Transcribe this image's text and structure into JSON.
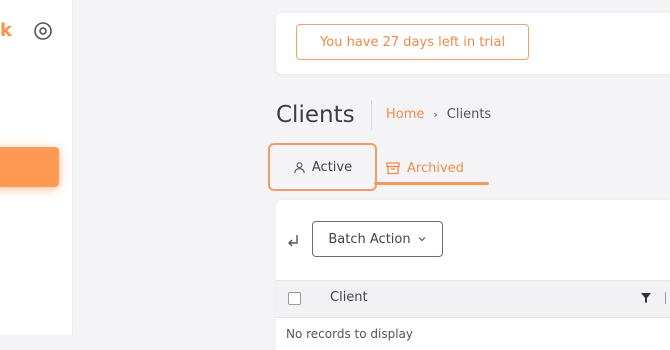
{
  "sidebar": {
    "logo_fragment": "k",
    "settings_icon": "target-icon",
    "active_item_color": "#ff9a55"
  },
  "trial": {
    "message": "You have 27 days left in trial"
  },
  "page": {
    "title": "Clients"
  },
  "breadcrumb": {
    "home": "Home",
    "separator": "›",
    "current": "Clients"
  },
  "tabs": [
    {
      "label": "Active",
      "icon": "user-icon",
      "selected": true
    },
    {
      "label": "Archived",
      "icon": "archive-icon",
      "selected": false
    }
  ],
  "toolbar": {
    "batch_action_label": "Batch Action"
  },
  "table": {
    "columns": [
      "Client"
    ],
    "empty_message": "No records to display"
  },
  "colors": {
    "accent": "#f08c4a",
    "page_bg": "#f4f4f6"
  }
}
